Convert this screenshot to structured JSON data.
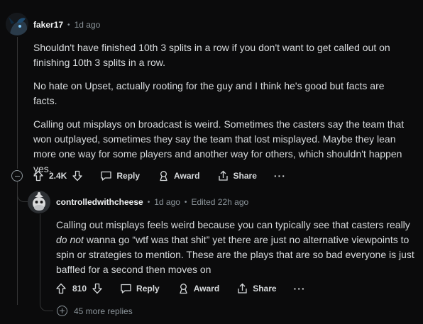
{
  "comment1": {
    "username": "faker17",
    "time": "1d ago",
    "paragraphs": [
      "Shouldn't have finished 10th 3 splits in a row if you don't want to get called out on finishing 10th 3 splits in a row.",
      "No hate on Upset, actually rooting for the guy and I think he's good but facts are facts.",
      "Calling out misplays on broadcast is weird. Sometimes the casters say the team that won outplayed, sometimes they say the team that lost misplayed. Maybe they lean more one way for some players and another way for others, which shouldn't happen yes."
    ],
    "votes": "2.4K",
    "reply_label": "Reply",
    "award_label": "Award",
    "share_label": "Share",
    "more_label": "···"
  },
  "comment2": {
    "username": "controlledwithcheese",
    "time": "1d ago",
    "edited": "Edited 22h ago",
    "text_part1": "Calling out misplays feels weird because you can typically see that casters really ",
    "text_em": "do not",
    "text_part2": " wanna go “wtf was that shit” yet there are just no alternative viewpoints to spin or strategies to mention. These are the plays that are so bad everyone is just baffled for a second then moves on",
    "votes": "810",
    "reply_label": "Reply",
    "award_label": "Award",
    "share_label": "Share",
    "more_label": "···"
  },
  "more_replies": "45 more replies",
  "colors": {
    "background": "#0b0b0c",
    "text": "#d7dadc",
    "meta": "#8c959b",
    "thread_line": "#343536"
  }
}
